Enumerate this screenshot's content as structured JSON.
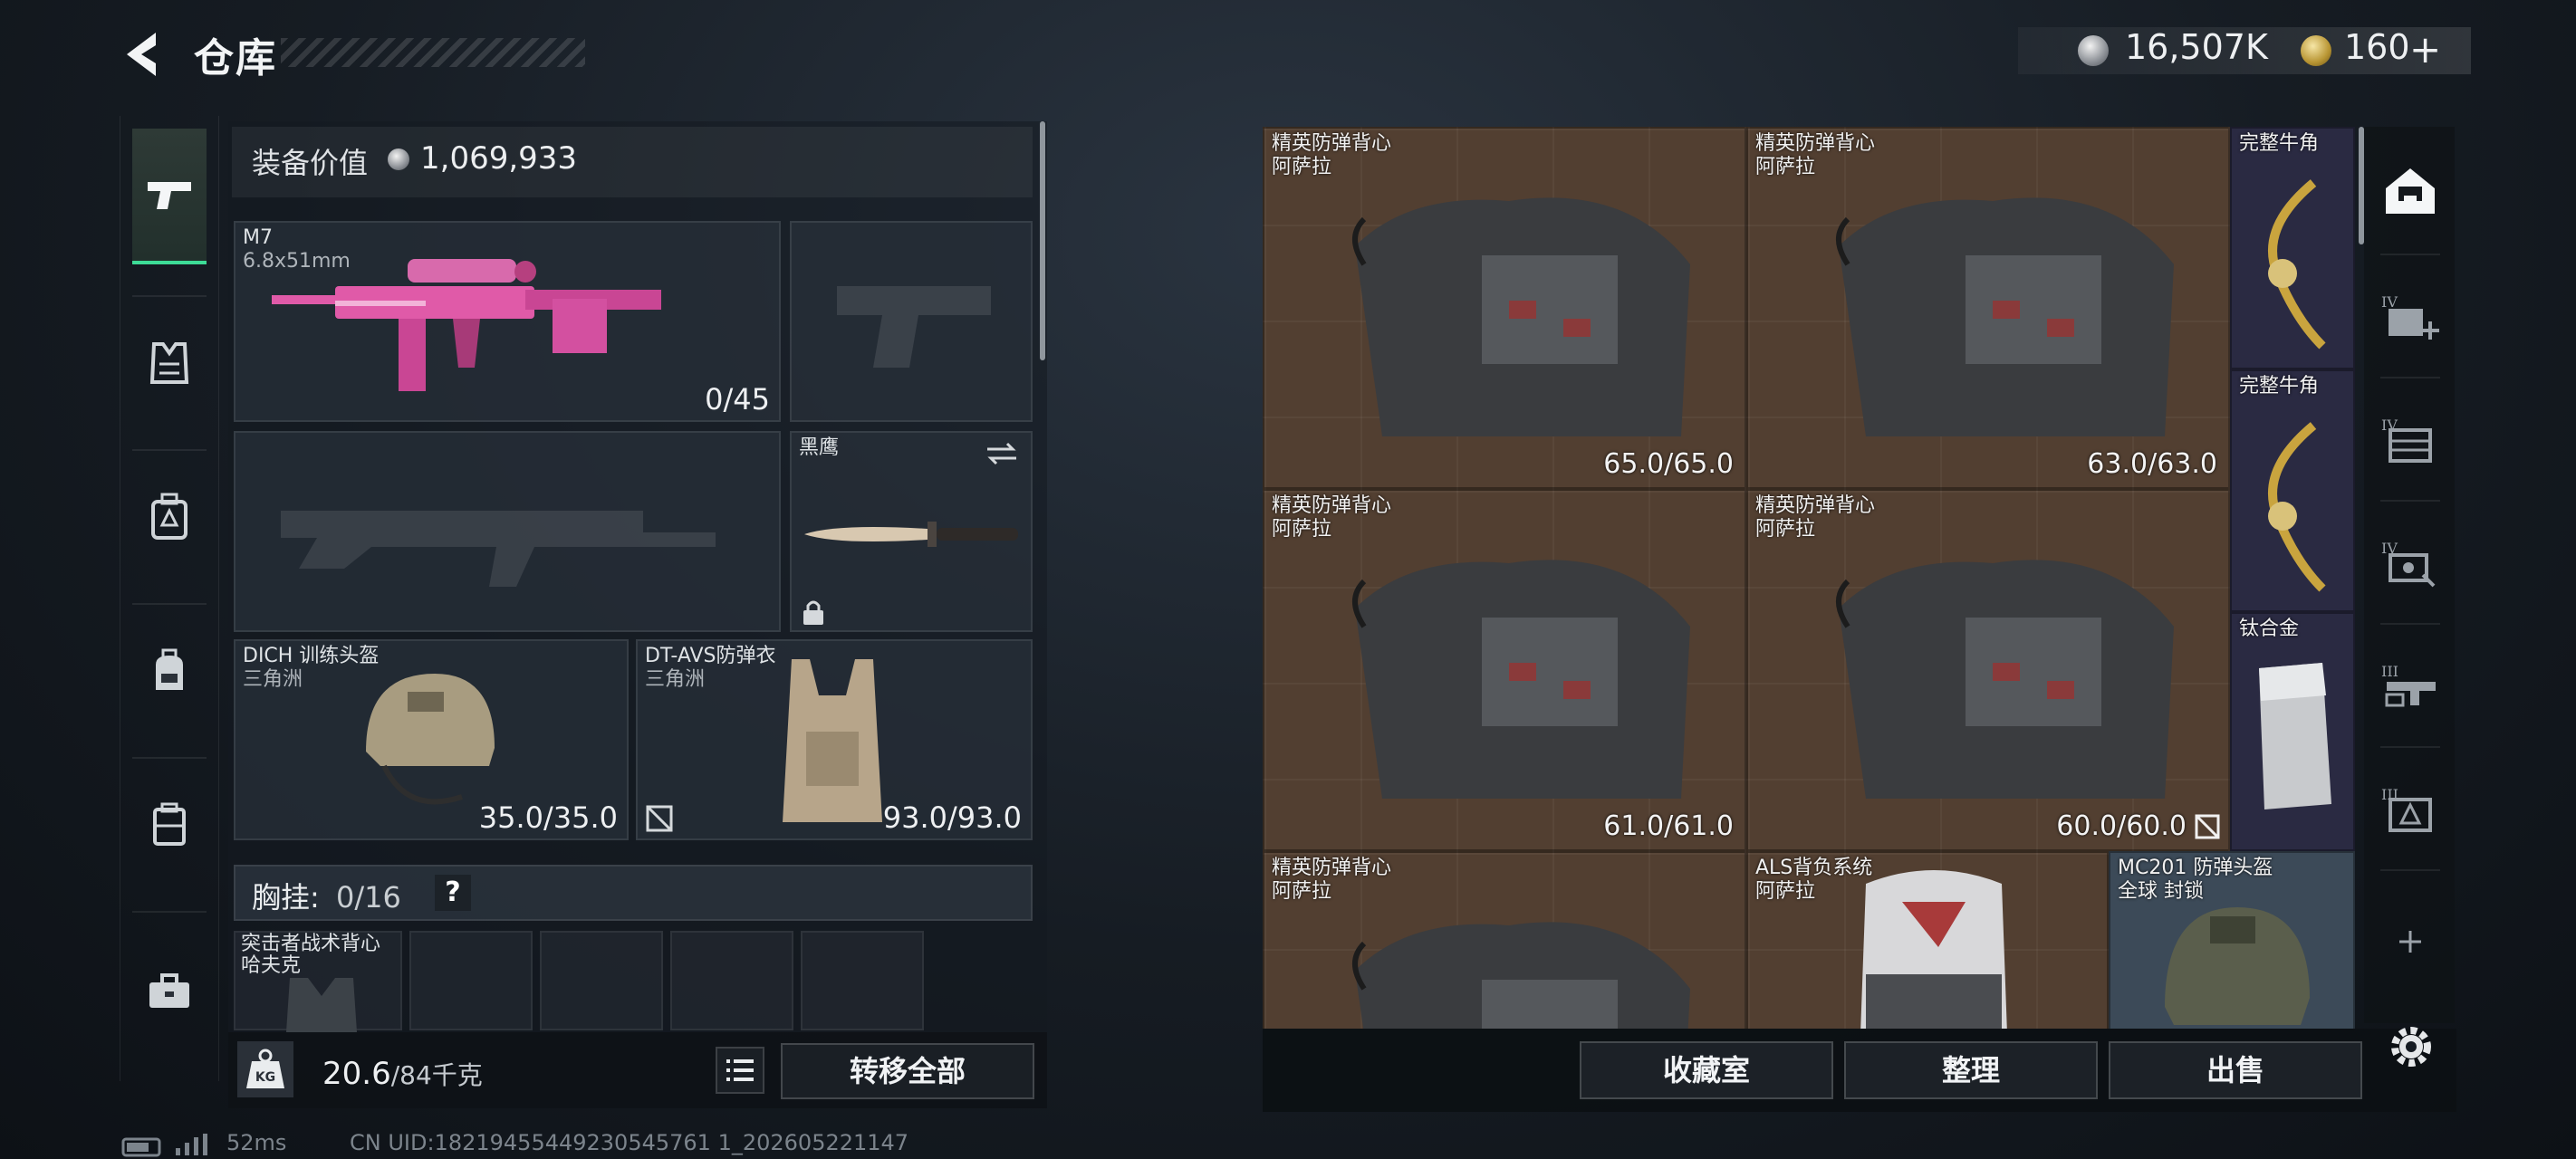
{
  "header": {
    "title": "仓库",
    "currency_silver": "16,507K",
    "currency_gold": "160",
    "gold_plus": "+"
  },
  "categories": [
    {
      "icon": "pistol-icon",
      "active": true
    },
    {
      "icon": "armor-vest-icon",
      "active": false
    },
    {
      "icon": "medkit-icon",
      "active": false
    },
    {
      "icon": "backpack-icon",
      "active": false
    },
    {
      "icon": "case-icon",
      "active": false
    },
    {
      "icon": "toolbox-icon",
      "active": false
    }
  ],
  "loadout": {
    "value_label": "装备价值",
    "value": "1,069,933",
    "primary": {
      "name": "M7",
      "sub": "6.8x51mm",
      "ammo": "0/45"
    },
    "melee": {
      "name": "黑鹰"
    },
    "helmet": {
      "name": "DICH 训练头盔",
      "sub": "三角洲",
      "durability": "35.0/35.0"
    },
    "armor": {
      "name": "DT-AVS防弹衣",
      "sub": "三角洲",
      "durability": "93.0/93.0"
    },
    "chest_rig": {
      "label": "胸挂:",
      "count": "0/16",
      "help": "?"
    },
    "rig_item": {
      "name": "突击者战术背心",
      "sub": "哈夫克"
    },
    "weight": {
      "current": "20.6",
      "max": "/84千克",
      "kg_label": "KG"
    },
    "transfer_all": "转移全部"
  },
  "storage": {
    "items": [
      {
        "name": "精英防弹背心",
        "sub": "阿萨拉",
        "stat": "65.0/65.0"
      },
      {
        "name": "精英防弹背心",
        "sub": "阿萨拉",
        "stat": "63.0/63.0"
      },
      {
        "name": "完整牛角",
        "sub": "",
        "stat": ""
      },
      {
        "name": "完整牛角",
        "sub": "",
        "stat": ""
      },
      {
        "name": "精英防弹背心",
        "sub": "阿萨拉",
        "stat": "61.0/61.0"
      },
      {
        "name": "精英防弹背心",
        "sub": "阿萨拉",
        "stat": "60.0/60.0"
      },
      {
        "name": "钛合金",
        "sub": "",
        "stat": ""
      },
      {
        "name": "精英防弹背心",
        "sub": "阿萨拉",
        "stat": ""
      },
      {
        "name": "ALS背负系统",
        "sub": "阿萨拉",
        "stat": ""
      },
      {
        "name": "MC201 防弹头盔",
        "sub": "全球 封锁",
        "stat": ""
      }
    ],
    "actions": {
      "collection": "收藏室",
      "sort": "整理",
      "sell": "出售"
    }
  },
  "side_tabs": [
    {
      "icon": "home-icon",
      "level": ""
    },
    {
      "icon": "medical-add-icon",
      "level": "IV"
    },
    {
      "icon": "storage-icon",
      "level": "IV"
    },
    {
      "icon": "workbench-icon",
      "level": "IV"
    },
    {
      "icon": "armory-icon",
      "level": "III"
    },
    {
      "icon": "facility-icon",
      "level": "III"
    },
    {
      "icon": "add-icon",
      "level": ""
    }
  ],
  "status": {
    "ping": "52ms",
    "uid": "CN UID:18219455449230545761 1_202605221147"
  },
  "colors": {
    "accent": "#3ddc97",
    "storage_brown": "#523f31",
    "storage_navy": "#2a2a42",
    "gun_pink": "#e05aa8"
  }
}
